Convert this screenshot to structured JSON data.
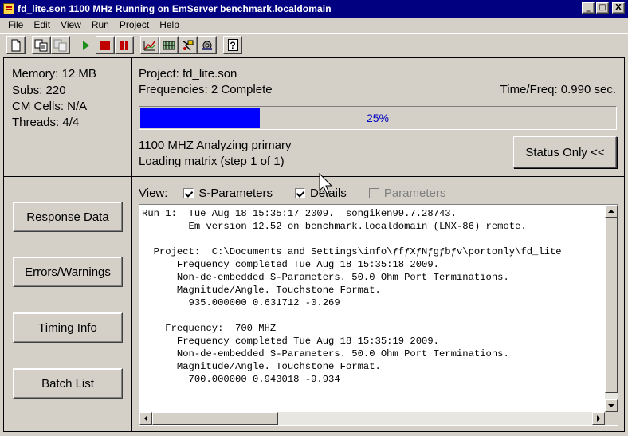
{
  "window": {
    "title": "fd_lite.son   1100 MHz Running on EmServer benchmark.localdomain",
    "minimize": "_",
    "maximize": "□",
    "close": "X"
  },
  "menu": [
    "File",
    "Edit",
    "View",
    "Run",
    "Project",
    "Help"
  ],
  "toolbar": {
    "buttons": [
      "new-file-icon",
      "copy-icon",
      "paste-icon",
      "run-icon",
      "stop-icon",
      "pause-icon",
      "graph-icon",
      "layout-icon",
      "probe-icon",
      "settings-gear-icon",
      "help-icon"
    ],
    "help_label": "?"
  },
  "stats": {
    "memory": "Memory: 12 MB",
    "subs": "Subs: 220",
    "cm_cells": "CM Cells: N/A",
    "threads": "Threads: 4/4"
  },
  "status": {
    "project": "Project:  fd_lite.son",
    "frequencies": "Frequencies:  2 Complete",
    "time_per_freq": "Time/Freq:  0.990 sec.",
    "progress_label": "25%",
    "progress_fraction": 0.25,
    "line1": "1100 MHZ Analyzing primary",
    "line2": "Loading matrix (step 1 of 1)",
    "status_button": "Status Only <<"
  },
  "side_buttons": {
    "response": "Response Data",
    "errors": "Errors/Warnings",
    "timing": "Timing Info",
    "batch": "Batch List"
  },
  "view": {
    "label": "View:",
    "sparams": "S-Parameters",
    "details": "Details",
    "parameters": "Parameters",
    "sparams_checked": true,
    "details_checked": true,
    "parameters_checked": false
  },
  "log": {
    "lines": [
      "Run 1:  Tue Aug 18 15:35:17 2009.  songiken99.7.28743.",
      "        Em version 12.52 on benchmark.localdomain (LNX-86) remote.",
      "",
      "  Project:  C:\\Documents and Settings\\info\\ƒfƒXƒNƒgƒbƒv\\portonly\\fd_lite",
      "      Frequency completed Tue Aug 18 15:35:18 2009.",
      "      Non-de-embedded S-Parameters. 50.0 Ohm Port Terminations.",
      "      Magnitude/Angle. Touchstone Format.",
      "        935.000000 0.631712 -0.269",
      "",
      "    Frequency:  700 MHZ",
      "      Frequency completed Tue Aug 18 15:35:19 2009.",
      "      Non-de-embedded S-Parameters. 50.0 Ohm Port Terminations.",
      "      Magnitude/Angle. Touchstone Format.",
      "        700.000000 0.943018 -9.934"
    ]
  },
  "colors": {
    "titlebar": "#000080",
    "progress_fill": "#0000ff",
    "progress_text": "#0000c0",
    "face": "#d4d0c8"
  }
}
